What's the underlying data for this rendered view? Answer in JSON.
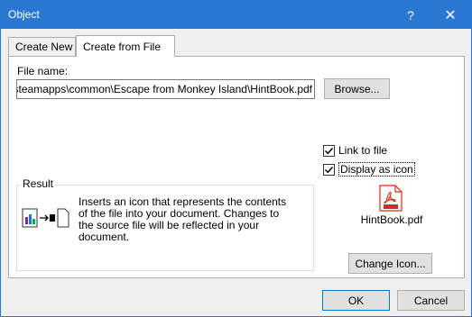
{
  "window": {
    "title": "Object",
    "help_label": "?",
    "close_label": "✕"
  },
  "tabs": [
    {
      "label": "Create New",
      "active": false
    },
    {
      "label": "Create from File",
      "active": true
    }
  ],
  "file": {
    "label": "File name:",
    "value": "\\steamapps\\common\\Escape from Monkey Island\\HintBook.pdf",
    "browse_label": "Browse..."
  },
  "options": {
    "link_to_file": {
      "label": "Link to file",
      "checked": true
    },
    "display_as_icon": {
      "label": "Display as icon",
      "checked": true
    }
  },
  "result": {
    "legend": "Result",
    "text": "Inserts an icon that represents the contents of the file into your document.  Changes to the source file will be reflected in your document."
  },
  "icon_preview": {
    "caption": "HintBook.pdf",
    "icon_name": "pdf-file-icon",
    "change_label": "Change Icon..."
  },
  "buttons": {
    "ok": "OK",
    "cancel": "Cancel"
  },
  "colors": {
    "titlebar": "#2b78d3",
    "pdf_red": "#d52b1e"
  }
}
